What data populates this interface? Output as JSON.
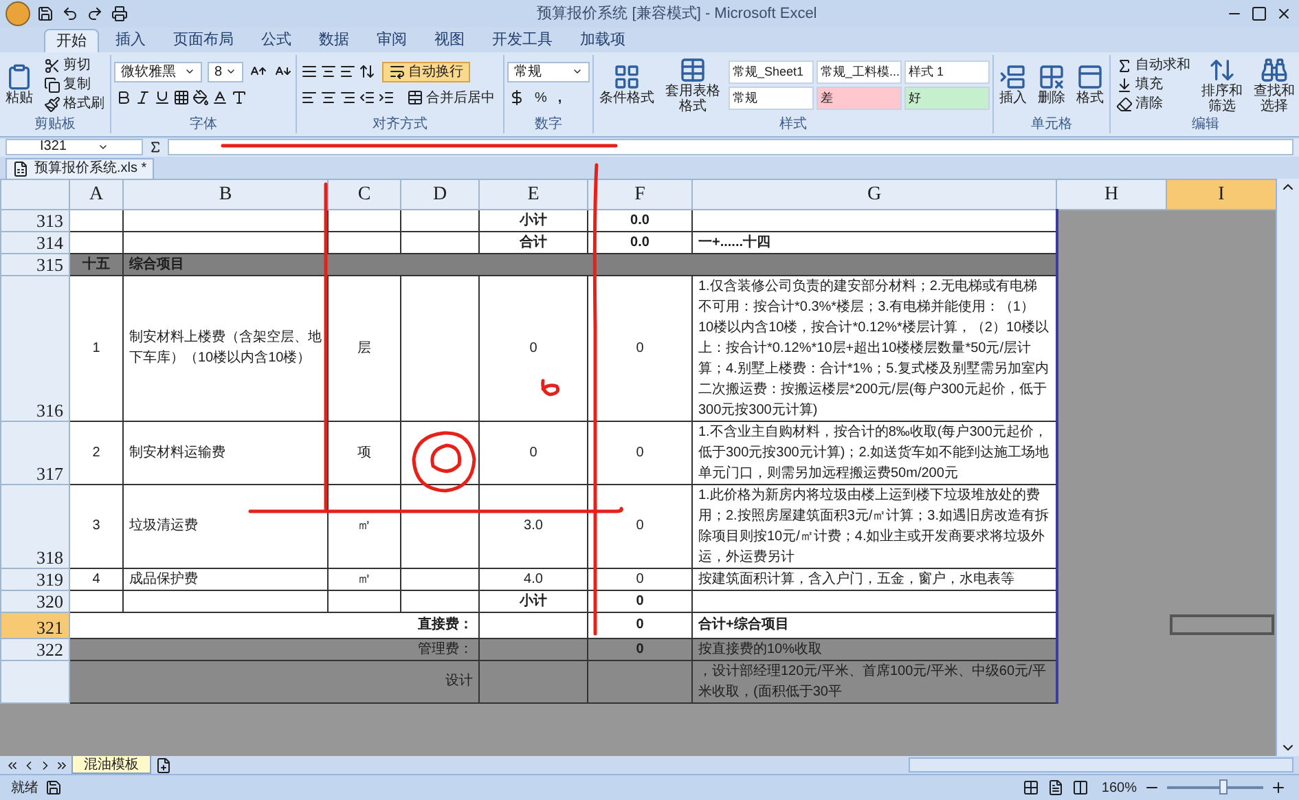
{
  "window": {
    "title": "预算报价系统 [兼容模式] - Microsoft Excel"
  },
  "tabs": [
    {
      "label": "开始",
      "selected": true
    },
    {
      "label": "插入",
      "selected": false
    },
    {
      "label": "页面布局",
      "selected": false
    },
    {
      "label": "公式",
      "selected": false
    },
    {
      "label": "数据",
      "selected": false
    },
    {
      "label": "审阅",
      "selected": false
    },
    {
      "label": "视图",
      "selected": false
    },
    {
      "label": "开发工具",
      "selected": false
    },
    {
      "label": "加载项",
      "selected": false
    }
  ],
  "ribbon": {
    "clipboard": {
      "label": "剪贴板",
      "paste": "粘贴",
      "cut": "剪切",
      "copy": "复制",
      "format_painter": "格式刷"
    },
    "font": {
      "label": "字体",
      "font_name": "微软雅黑",
      "font_size": "8"
    },
    "alignment": {
      "label": "对齐方式",
      "wrap_text": "自动换行",
      "merge_center": "合并后居中"
    },
    "number": {
      "label": "数字",
      "format": "常规",
      "percent": "%",
      "comma": ","
    },
    "styles": {
      "label": "样式",
      "conditional_format": "条件格式",
      "table_format": "套用表格格式",
      "style_cells": [
        {
          "label": "常规_Sheet1",
          "color": "#ffffff"
        },
        {
          "label": "常规_工料模...",
          "color": "#ffffff"
        },
        {
          "label": "样式 1",
          "color": "#ffffff"
        },
        {
          "label": "常规",
          "color": "#ffffff"
        },
        {
          "label": "差",
          "color": "#ffc7ce"
        },
        {
          "label": "好",
          "color": "#c6efce"
        }
      ]
    },
    "cells": {
      "label": "单元格",
      "insert": "插入",
      "delete": "删除",
      "format": "格式"
    },
    "editing": {
      "label": "编辑",
      "autosum": "自动求和",
      "fill": "填充",
      "clear": "清除",
      "sort_filter": "排序和筛选",
      "find_select": "查找和选择"
    }
  },
  "formula_bar": {
    "name_box": "I321"
  },
  "workbook_tab": "预算报价系统.xls *",
  "columns": [
    {
      "label": "A",
      "selected": false
    },
    {
      "label": "B",
      "selected": false
    },
    {
      "label": "C",
      "selected": false
    },
    {
      "label": "D",
      "selected": false
    },
    {
      "label": "E",
      "selected": false
    },
    {
      "label": "F",
      "selected": false
    },
    {
      "label": "G",
      "selected": false
    },
    {
      "label": "H",
      "selected": false
    },
    {
      "label": "I",
      "selected": true
    }
  ],
  "rows": [
    {
      "number": "313",
      "kind": "subtotal",
      "selected": false,
      "cells": {
        "e": "小计",
        "f": "0.0"
      }
    },
    {
      "number": "314",
      "kind": "subtotal",
      "selected": false,
      "cells": {
        "e": "合计",
        "f": "0.0",
        "g": "一+......十四"
      }
    },
    {
      "number": "315",
      "kind": "section",
      "selected": false,
      "cells": {
        "a": "十五",
        "b": "综合项目"
      }
    },
    {
      "number": "316",
      "kind": "item",
      "selected": false,
      "cells": {
        "a": "1",
        "b": "制安材料上楼费（含架空层、地下车库）（10楼以内含10楼）",
        "c": "层",
        "e": "0",
        "f": "0",
        "g": "1.仅含装修公司负责的建安部分材料；2.无电梯或有电梯不可用：按合计*0.3%*楼层；3.有电梯并能使用：（1）10楼以内含10楼，按合计*0.12%*楼层计算，（2）10楼以上：按合计*0.12%*10层+超出10楼楼层数量*50元/层计算；4.别墅上楼费：合计*1%；5.复式楼及别墅需另加室内二次搬运费：按搬运楼层*200元/层(每户300元起价，低于300元按300元计算)"
      }
    },
    {
      "number": "317",
      "kind": "item",
      "selected": false,
      "cells": {
        "a": "2",
        "b": "制安材料运输费",
        "c": "项",
        "e": "0",
        "f": "0",
        "g": "1.不含业主自购材料，按合计的8‰收取(每户300元起价，低于300元按300元计算)；2.如送货车如不能到达施工场地单元门口，则需另加远程搬运费50m/200元"
      }
    },
    {
      "number": "318",
      "kind": "item",
      "selected": false,
      "cells": {
        "a": "3",
        "b": "垃圾清运费",
        "c": "㎡",
        "e": "3.0",
        "f": "0",
        "g": "1.此价格为新房内将垃圾由楼上运到楼下垃圾堆放处的费用；2.按照房屋建筑面积3元/㎡计算；3.如遇旧房改造有拆除项目则按10元/㎡计费；4.如业主或开发商要求将垃圾外运，外运费另计"
      }
    },
    {
      "number": "319",
      "kind": "item",
      "selected": false,
      "cells": {
        "a": "4",
        "b": "成品保护费",
        "c": "㎡",
        "e": "4.0",
        "f": "0",
        "g": "按建筑面积计算，含入户门，五金，窗户，水电表等"
      }
    },
    {
      "number": "320",
      "kind": "subtotal",
      "selected": false,
      "cells": {
        "e": "小计",
        "f": "0"
      }
    },
    {
      "number": "321",
      "kind": "total",
      "selected": true,
      "cells": {
        "label": "直接费：",
        "f": "0",
        "g": "合计+综合项目"
      }
    },
    {
      "number": "322",
      "kind": "fee",
      "selected": false,
      "cells": {
        "label": "管理费：",
        "f": "0",
        "g": "按直接费的10%收取"
      }
    },
    {
      "kind": "fee",
      "selected": false,
      "cells": {
        "label": "设计",
        "g": "，设计部经理120元/平米、首席100元/平米、中级60元/平米收取，(面积低于30平"
      }
    }
  ],
  "sheet_tabs": [
    {
      "label": "混油模板",
      "selected": true
    }
  ],
  "status_bar": {
    "status": "就绪",
    "zoom": "160%",
    "zoom_slider": {
      "level": 0.58
    }
  }
}
